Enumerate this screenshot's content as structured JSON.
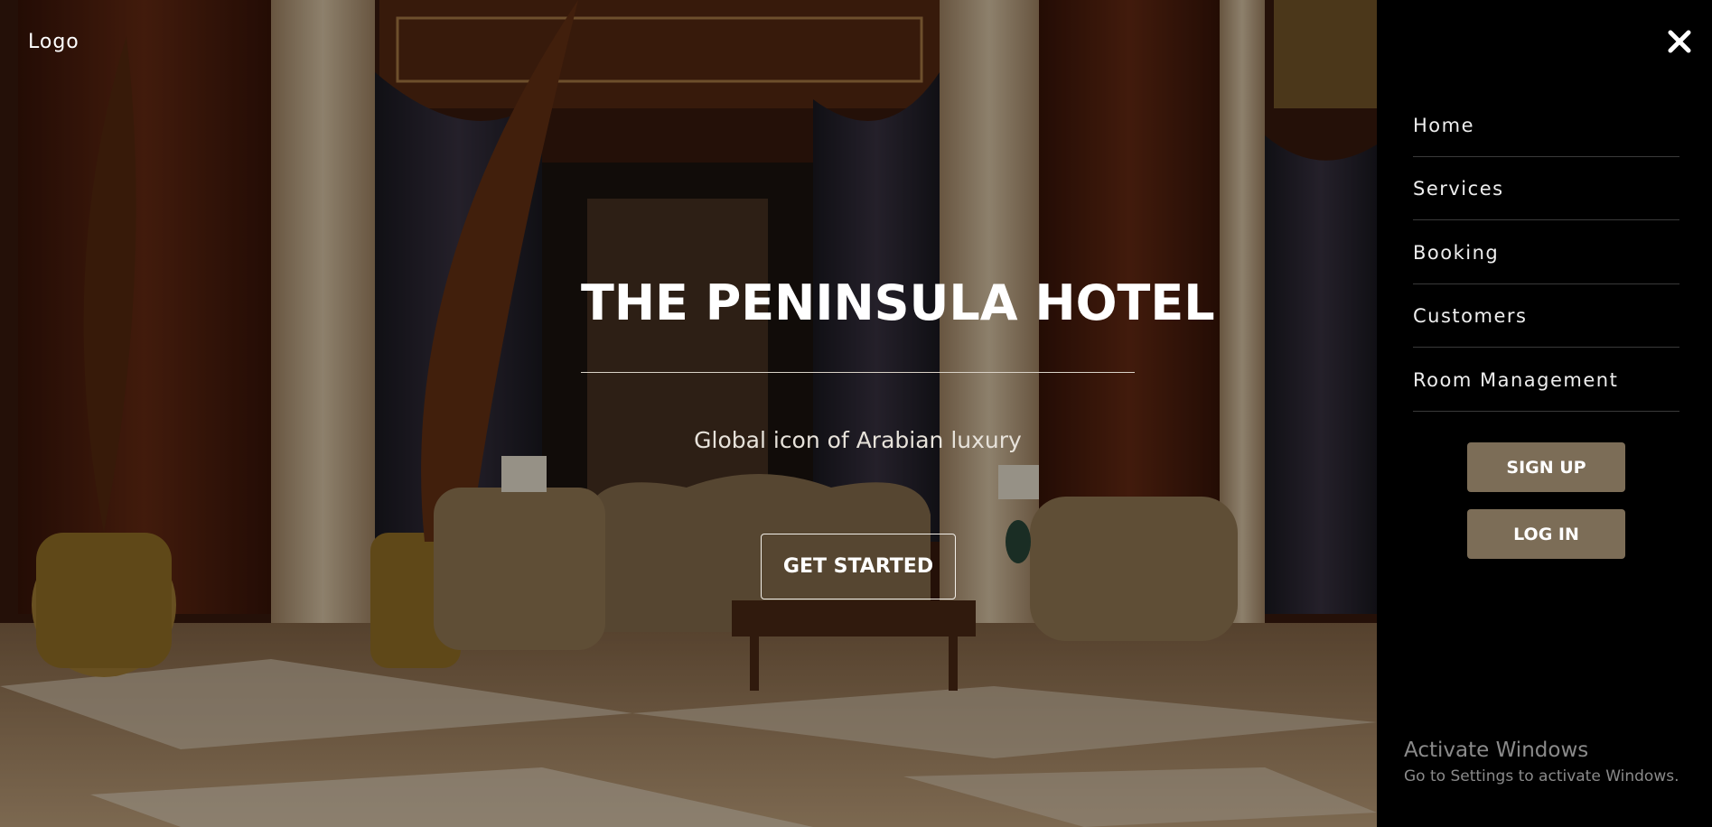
{
  "header": {
    "logo_text": "Logo"
  },
  "hero": {
    "title": "THE PENINSULA HOTEL",
    "subtitle": "Global icon of Arabian luxury",
    "cta_label": "GET STARTED"
  },
  "sidenav": {
    "close_icon": "close-icon",
    "items": [
      {
        "label": "Home"
      },
      {
        "label": "Services"
      },
      {
        "label": "Booking"
      },
      {
        "label": "Customers"
      },
      {
        "label": "Room Management"
      }
    ],
    "signup_label": "SIGN UP",
    "login_label": "LOG IN",
    "button_color": "#7c6d57"
  },
  "watermark": {
    "title": "Activate Windows",
    "text": "Go to Settings to activate Windows."
  }
}
